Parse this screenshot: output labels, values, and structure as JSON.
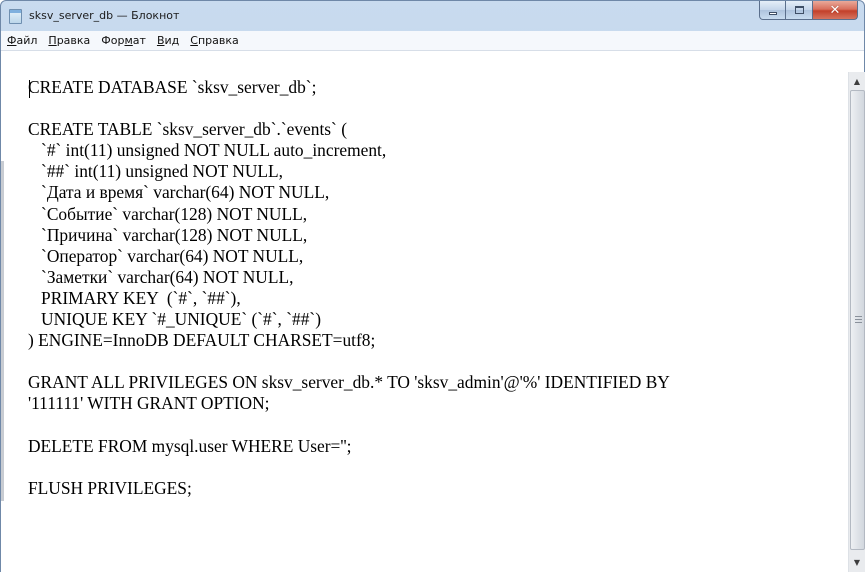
{
  "window": {
    "title": "sksv_server_db — Блокнот",
    "controls": {
      "minimize_icon": "minimize-icon",
      "maximize_icon": "maximize-icon",
      "close_label": "✕"
    }
  },
  "menu": {
    "items": [
      {
        "accel": "Ф",
        "rest": "айл"
      },
      {
        "accel": "П",
        "rest": "равка"
      },
      {
        "pre": "Фор",
        "accel": "м",
        "rest": "ат"
      },
      {
        "accel": "В",
        "rest": "ид"
      },
      {
        "accel": "С",
        "rest": "правка"
      }
    ]
  },
  "editor": {
    "lines": [
      "CREATE DATABASE `sksv_server_db`;",
      "",
      "CREATE TABLE `sksv_server_db`.`events` (",
      "   `#` int(11) unsigned NOT NULL auto_increment,",
      "   `##` int(11) unsigned NOT NULL,",
      "   `Дата и время` varchar(64) NOT NULL,",
      "   `Событие` varchar(128) NOT NULL,",
      "   `Причина` varchar(128) NOT NULL,",
      "   `Оператор` varchar(64) NOT NULL,",
      "   `Заметки` varchar(64) NOT NULL,",
      "   PRIMARY KEY  (`#`, `##`),",
      "   UNIQUE KEY `#_UNIQUE` (`#`, `##`)",
      ") ENGINE=InnoDB DEFAULT CHARSET=utf8;",
      "",
      "GRANT ALL PRIVILEGES ON sksv_server_db.* TO 'sksv_admin'@'%' IDENTIFIED BY",
      "'111111' WITH GRANT OPTION;",
      "",
      "DELETE FROM mysql.user WHERE User='';",
      "",
      "FLUSH PRIVILEGES;"
    ]
  },
  "scrollbar": {
    "up_glyph": "▲",
    "down_glyph": "▼"
  }
}
